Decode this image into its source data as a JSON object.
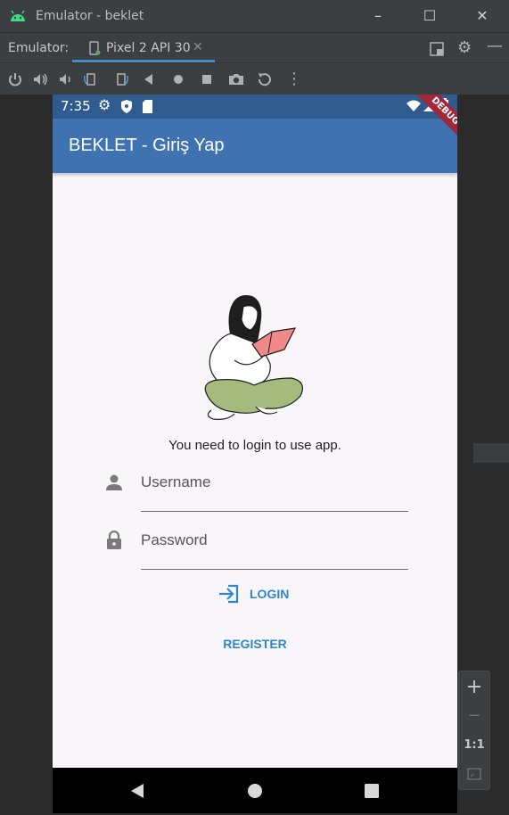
{
  "window": {
    "title": "Emulator - beklet"
  },
  "tabs": {
    "label": "Emulator:",
    "device_tab": "Pixel 2 API 30"
  },
  "statusbar": {
    "time": "7:35"
  },
  "app": {
    "title": "BEKLET - Giriş Yap",
    "debug_banner": "DEBUG",
    "message": "You need to login to use app.",
    "username_placeholder": "Username",
    "password_placeholder": "Password",
    "login_label": "LOGIN",
    "register_label": "REGISTER",
    "accent": "#2d86d4",
    "appbar_color": "#3f72b1"
  },
  "zoom": {
    "plus": "+",
    "minus": "−",
    "one_to_one": "1:1"
  }
}
